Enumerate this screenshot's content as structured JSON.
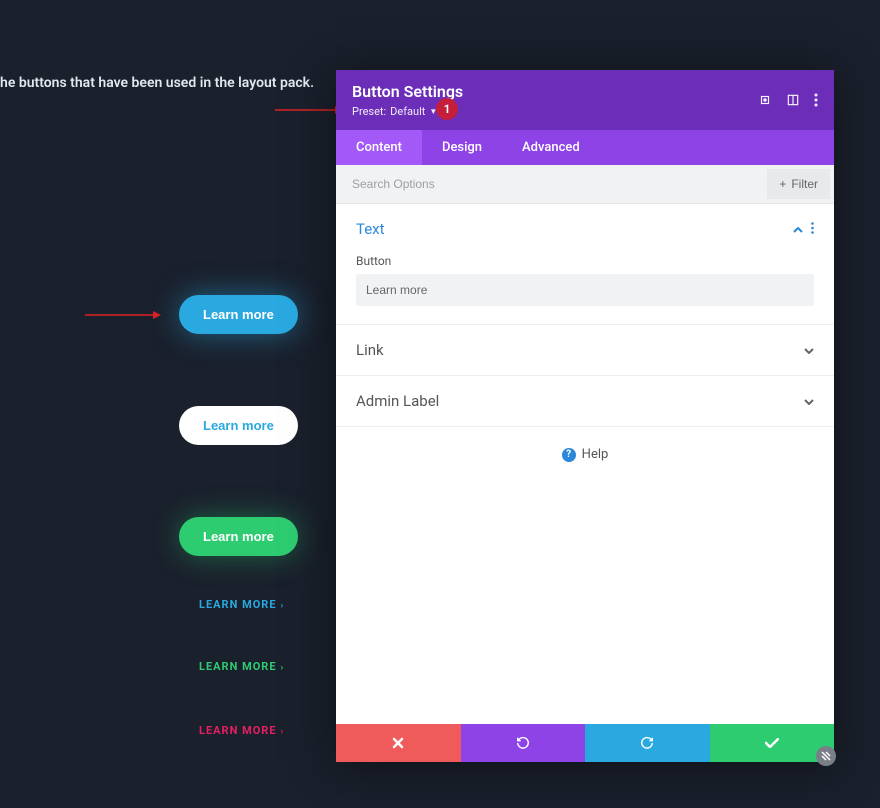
{
  "bg_text": "he buttons that have been used in the layout pack.",
  "badge1": "1",
  "preview_buttons": {
    "blue": "Learn more",
    "white": "Learn more",
    "teal": "Learn more"
  },
  "preview_links": {
    "blue": "LEARN MORE",
    "teal": "LEARN MORE",
    "pink": "LEARN MORE"
  },
  "modal": {
    "title": "Button Settings",
    "preset_label": "Preset:",
    "preset_value": "Default",
    "tabs": {
      "content": "Content",
      "design": "Design",
      "advanced": "Advanced"
    },
    "search_placeholder": "Search Options",
    "filter_label": "Filter",
    "sections": {
      "text": {
        "title": "Text",
        "field_label": "Button",
        "field_value": "Learn more"
      },
      "link": {
        "title": "Link"
      },
      "admin": {
        "title": "Admin Label"
      }
    },
    "help": "Help"
  }
}
